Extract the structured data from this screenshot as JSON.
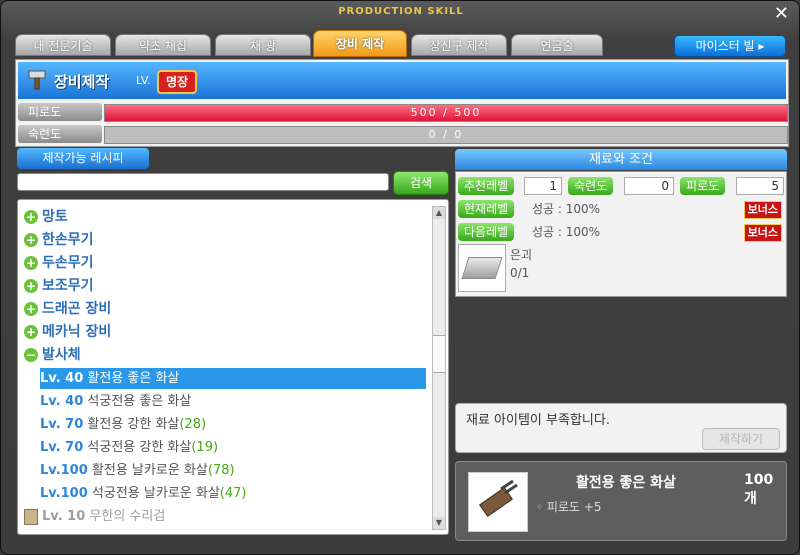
{
  "window": {
    "title": "PRODUCTION SKILL",
    "close": "✕"
  },
  "tabs": [
    {
      "label": "내 전문기술"
    },
    {
      "label": "약초 채집"
    },
    {
      "label": "채 광"
    },
    {
      "label": "장비 제작"
    },
    {
      "label": "장신구 제작"
    },
    {
      "label": "연금술"
    }
  ],
  "master_button": "마이스터 빌 ▸",
  "skill": {
    "name": "장비제작",
    "lv_label": "LV.",
    "rank": "명장"
  },
  "fatigue": {
    "label": "피로도",
    "text": "500 / 500",
    "fraction": 1.0
  },
  "proficiency": {
    "label": "숙련도",
    "text": "0 / 0",
    "fraction": 0.0
  },
  "recipes": {
    "tab": "제작가능 레시피",
    "search_placeholder": "",
    "search_button": "검색",
    "categories": [
      {
        "label": "망토"
      },
      {
        "label": "한손무기"
      },
      {
        "label": "두손무기"
      },
      {
        "label": "보조무기"
      },
      {
        "label": "드래곤 장비"
      },
      {
        "label": "메카닉 장비"
      },
      {
        "label": "발사체"
      }
    ],
    "items": [
      {
        "lv": "Lv. 40",
        "name": "활전용 좋은 화살",
        "count": ""
      },
      {
        "lv": "Lv. 40",
        "name": "석궁전용 좋은 화살",
        "count": ""
      },
      {
        "lv": "Lv. 70",
        "name": "활전용 강한 화살",
        "count": "(28)"
      },
      {
        "lv": "Lv. 70",
        "name": "석궁전용 강한 화살",
        "count": "(19)"
      },
      {
        "lv": "Lv.100",
        "name": "활전용 날카로운 화살",
        "count": "(78)"
      },
      {
        "lv": "Lv.100",
        "name": "석궁전용 날카로운 화살",
        "count": "(47)"
      },
      {
        "lv": "Lv. 10",
        "name": "무한의 수리검",
        "count": ""
      }
    ]
  },
  "conditions": {
    "title": "재료와 조건",
    "rec_level": {
      "label": "추천레벨",
      "value": "1"
    },
    "proficiency": {
      "label": "숙련도",
      "value": "0"
    },
    "fatigue": {
      "label": "피로도",
      "value": "5"
    },
    "current": {
      "label": "현재레벨",
      "text": "성공 : 100%",
      "bonus": "보너스"
    },
    "next": {
      "label": "다음레벨",
      "text": "성공 : 100%",
      "bonus": "보너스"
    },
    "material": {
      "name": "은괴",
      "qty": "0/1"
    }
  },
  "message": "재료 아이템이 부족합니다.",
  "make_button": "제작하기",
  "result": {
    "name": "활전용 좋은 화살",
    "count": "100개",
    "stat": "◦ 피로도 +5"
  }
}
